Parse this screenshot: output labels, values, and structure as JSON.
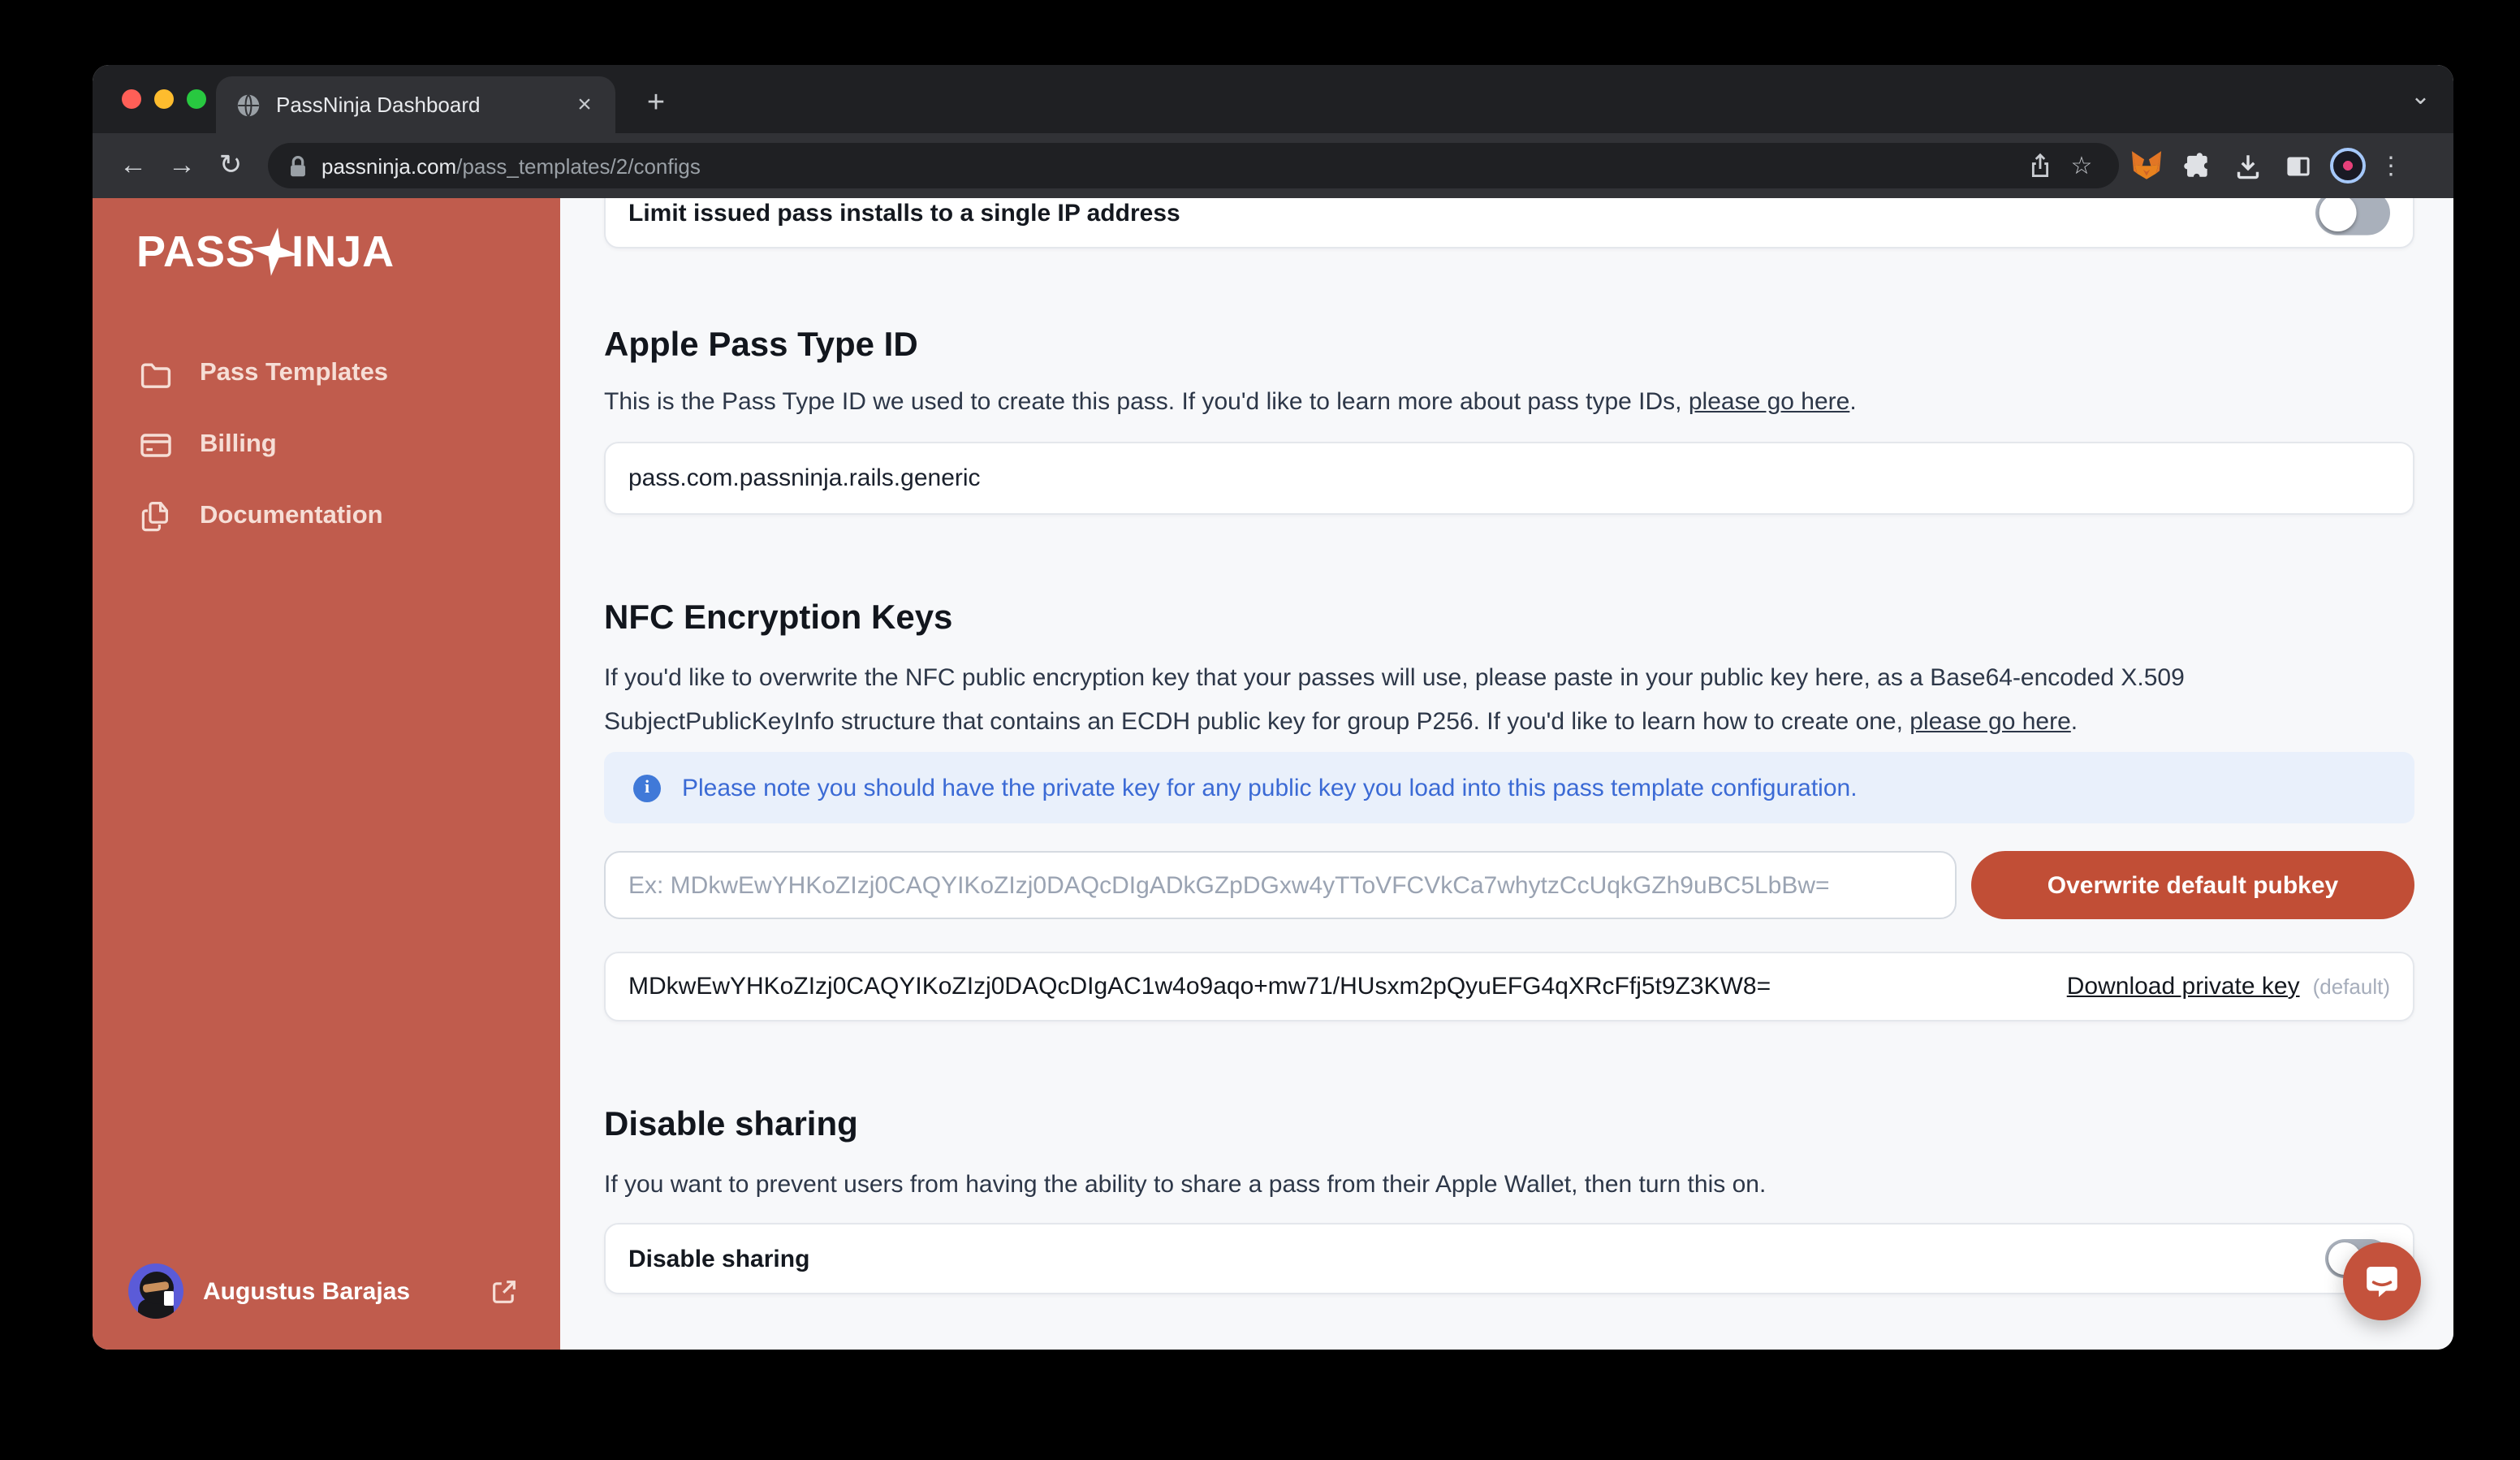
{
  "browser": {
    "tab": {
      "title": "PassNinja Dashboard"
    },
    "url": {
      "host": "passninja.com",
      "path": "/pass_templates/2/configs"
    },
    "glyphs": {
      "close": "×",
      "new_tab": "+",
      "tab_overflow": "⌄",
      "back": "←",
      "forward": "→",
      "reload": "↻",
      "bookmark": "☆",
      "menu": "⋮"
    }
  },
  "sidebar": {
    "logo": {
      "left": "PASS",
      "right": "INJA"
    },
    "items": [
      {
        "label": "Pass Templates",
        "icon": "folder-icon"
      },
      {
        "label": "Billing",
        "icon": "credit-card-icon"
      },
      {
        "label": "Documentation",
        "icon": "documents-icon"
      }
    ],
    "user": {
      "name": "Augustus Barajas"
    }
  },
  "content": {
    "ip_limit_row": {
      "label": "Limit issued pass installs to a single IP address",
      "toggle_state": "off"
    },
    "apple_section": {
      "title": "Apple Pass Type ID",
      "description": "This is the Pass Type ID we used to create this pass. If you'd like to learn more about pass type IDs, ",
      "link_text": "please go here",
      "period": ".",
      "pass_type_id": "pass.com.passninja.rails.generic"
    },
    "nfc_section": {
      "title": "NFC Encryption Keys",
      "description": "If you'd like to overwrite the NFC public encryption key that your passes will use, please paste in your public key here, as a Base64-encoded X.509 SubjectPublicKeyInfo structure that contains an ECDH public key for group P256. If you'd like to learn how to create one, ",
      "link_text": "please go here",
      "period": ".",
      "note_icon": "i",
      "note": "Please note you should have the private key for any public key you load into this pass template configuration.",
      "pubkey_placeholder": "Ex: MDkwEwYHKoZIzj0CAQYIKoZIzj0DAQcDIgADkGZpDGxw4yTToVFCVkCa7whytzCcUqkGZh9uBC5LbBw=",
      "overwrite_button": "Overwrite default pubkey",
      "current_key": "MDkwEwYHKoZIzj0CAQYIKoZIzj0DAQcDIgAC1w4o9aqo+mw71/HUsxm2pQyuEFG4qXRcFfj5t9Z3KW8=",
      "download_link": "Download private key",
      "default_tag": "(default)"
    },
    "sharing_section": {
      "title": "Disable sharing",
      "description": "If you want to prevent users from having the ability to share a pass from their Apple Wallet, then turn this on.",
      "row_label": "Disable sharing",
      "toggle_state": "off"
    }
  },
  "colors": {
    "sidebar": "#C05C4D",
    "primary_button": "#C14E36",
    "note_text": "#3B6AD5",
    "note_bg": "#E9F0FB",
    "main_bg": "#F7F8FA",
    "toggle_off": "#A9B0BB"
  }
}
